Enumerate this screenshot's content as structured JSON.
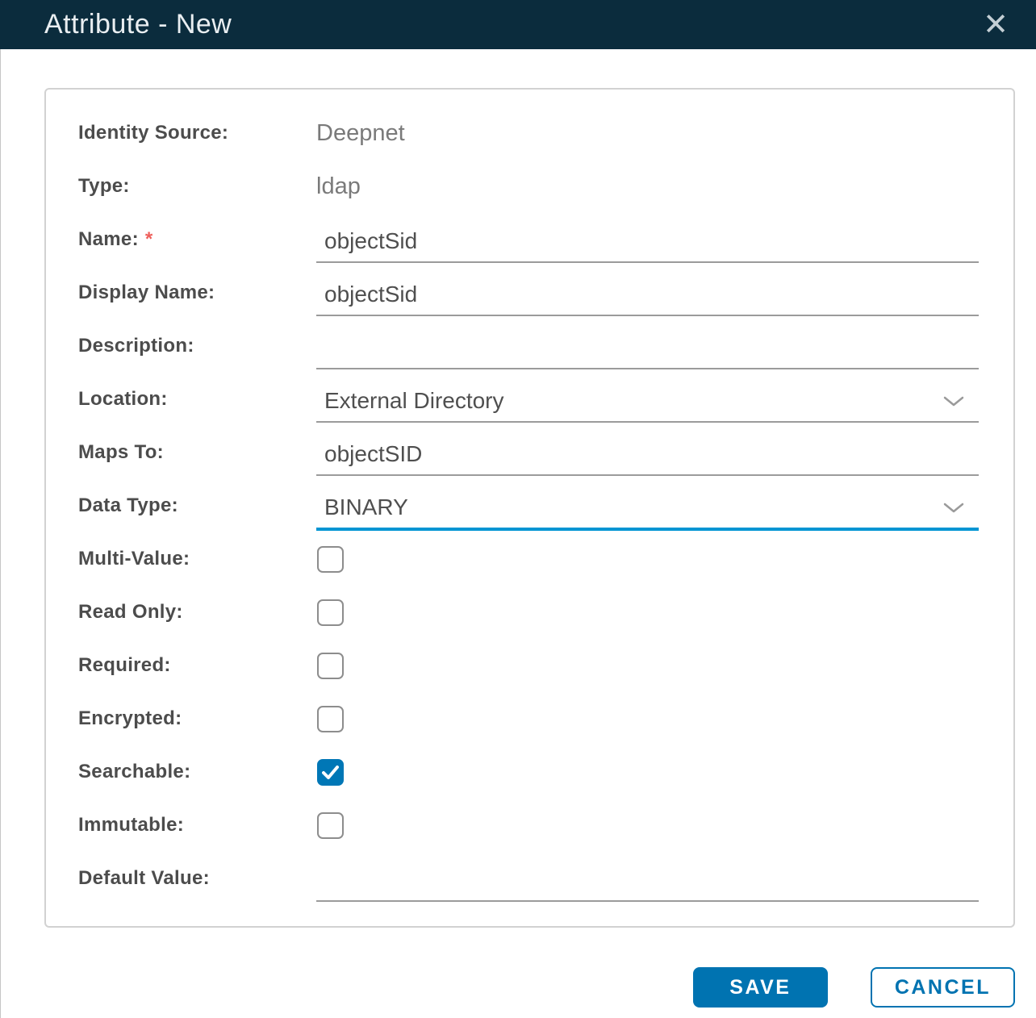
{
  "dialog": {
    "title": "Attribute - New",
    "close_icon": "✕"
  },
  "form": {
    "required_marker": "*",
    "fields": [
      {
        "label": "Identity Source:",
        "type": "static",
        "value": "Deepnet"
      },
      {
        "label": "Type:",
        "type": "static",
        "value": "ldap"
      },
      {
        "label": "Name:",
        "type": "text",
        "value": "objectSid",
        "required": true
      },
      {
        "label": "Display Name:",
        "type": "text",
        "value": "objectSid"
      },
      {
        "label": "Description:",
        "type": "text",
        "value": ""
      },
      {
        "label": "Location:",
        "type": "select",
        "value": "External Directory"
      },
      {
        "label": "Maps To:",
        "type": "text",
        "value": "objectSID"
      },
      {
        "label": "Data Type:",
        "type": "select",
        "value": "BINARY",
        "active": true
      },
      {
        "label": "Multi-Value:",
        "type": "checkbox",
        "checked": false
      },
      {
        "label": "Read Only:",
        "type": "checkbox",
        "checked": false
      },
      {
        "label": "Required:",
        "type": "checkbox",
        "checked": false
      },
      {
        "label": "Encrypted:",
        "type": "checkbox",
        "checked": false
      },
      {
        "label": "Searchable:",
        "type": "checkbox",
        "checked": true
      },
      {
        "label": "Immutable:",
        "type": "checkbox",
        "checked": false
      },
      {
        "label": "Default Value:",
        "type": "text",
        "value": ""
      }
    ]
  },
  "footer": {
    "save_label": "SAVE",
    "cancel_label": "CANCEL"
  },
  "colors": {
    "header_bg": "#0b2c3d",
    "primary_button": "#0073b1",
    "active_underline": "#0095d3",
    "checkbox_checked": "#0077b6",
    "required_marker": "#ee5f5b"
  }
}
